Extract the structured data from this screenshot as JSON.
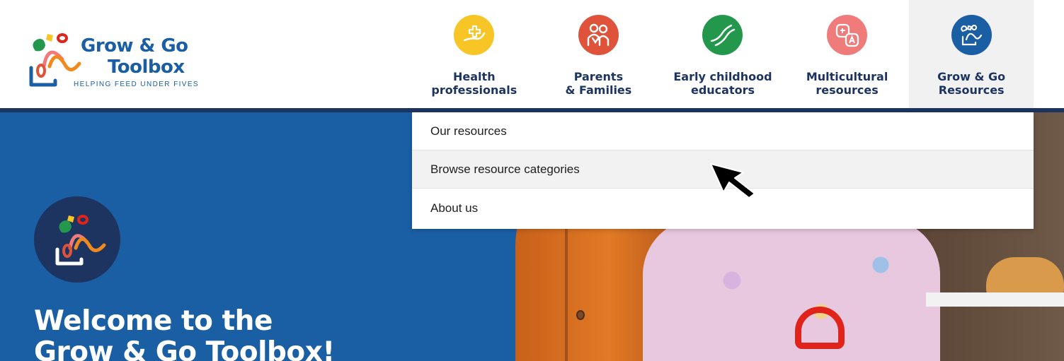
{
  "brand": {
    "name_line1": "Grow & Go",
    "name_line2": "Toolbox",
    "tagline": "HELPING FEED UNDER FIVES"
  },
  "nav": {
    "items": [
      {
        "label": "Health\nprofessionals",
        "color": "#f7c525",
        "icon": "hand-heart-icon"
      },
      {
        "label": "Parents\n& Families",
        "color": "#e0533b",
        "icon": "family-icon"
      },
      {
        "label": "Early childhood\neducators",
        "color": "#23984c",
        "icon": "hands-icon"
      },
      {
        "label": "Multicultural\nresources",
        "color": "#f07b7b",
        "icon": "translate-icon"
      },
      {
        "label": "Grow & Go\nResources",
        "color": "#1a5ea4",
        "icon": "toolbox-icon"
      }
    ],
    "active_index": 4
  },
  "dropdown": {
    "items": [
      {
        "label": "Our resources"
      },
      {
        "label": "Browse resource categories"
      },
      {
        "label": "About us"
      }
    ],
    "hover_index": 1
  },
  "hero": {
    "title": "Welcome to the\nGrow & Go Toolbox!"
  },
  "colors": {
    "primary_blue": "#1a5ea4",
    "navy": "#1d3461",
    "yellow": "#f7c525",
    "red": "#e0533b",
    "green": "#23984c",
    "pink": "#f07b7b"
  }
}
